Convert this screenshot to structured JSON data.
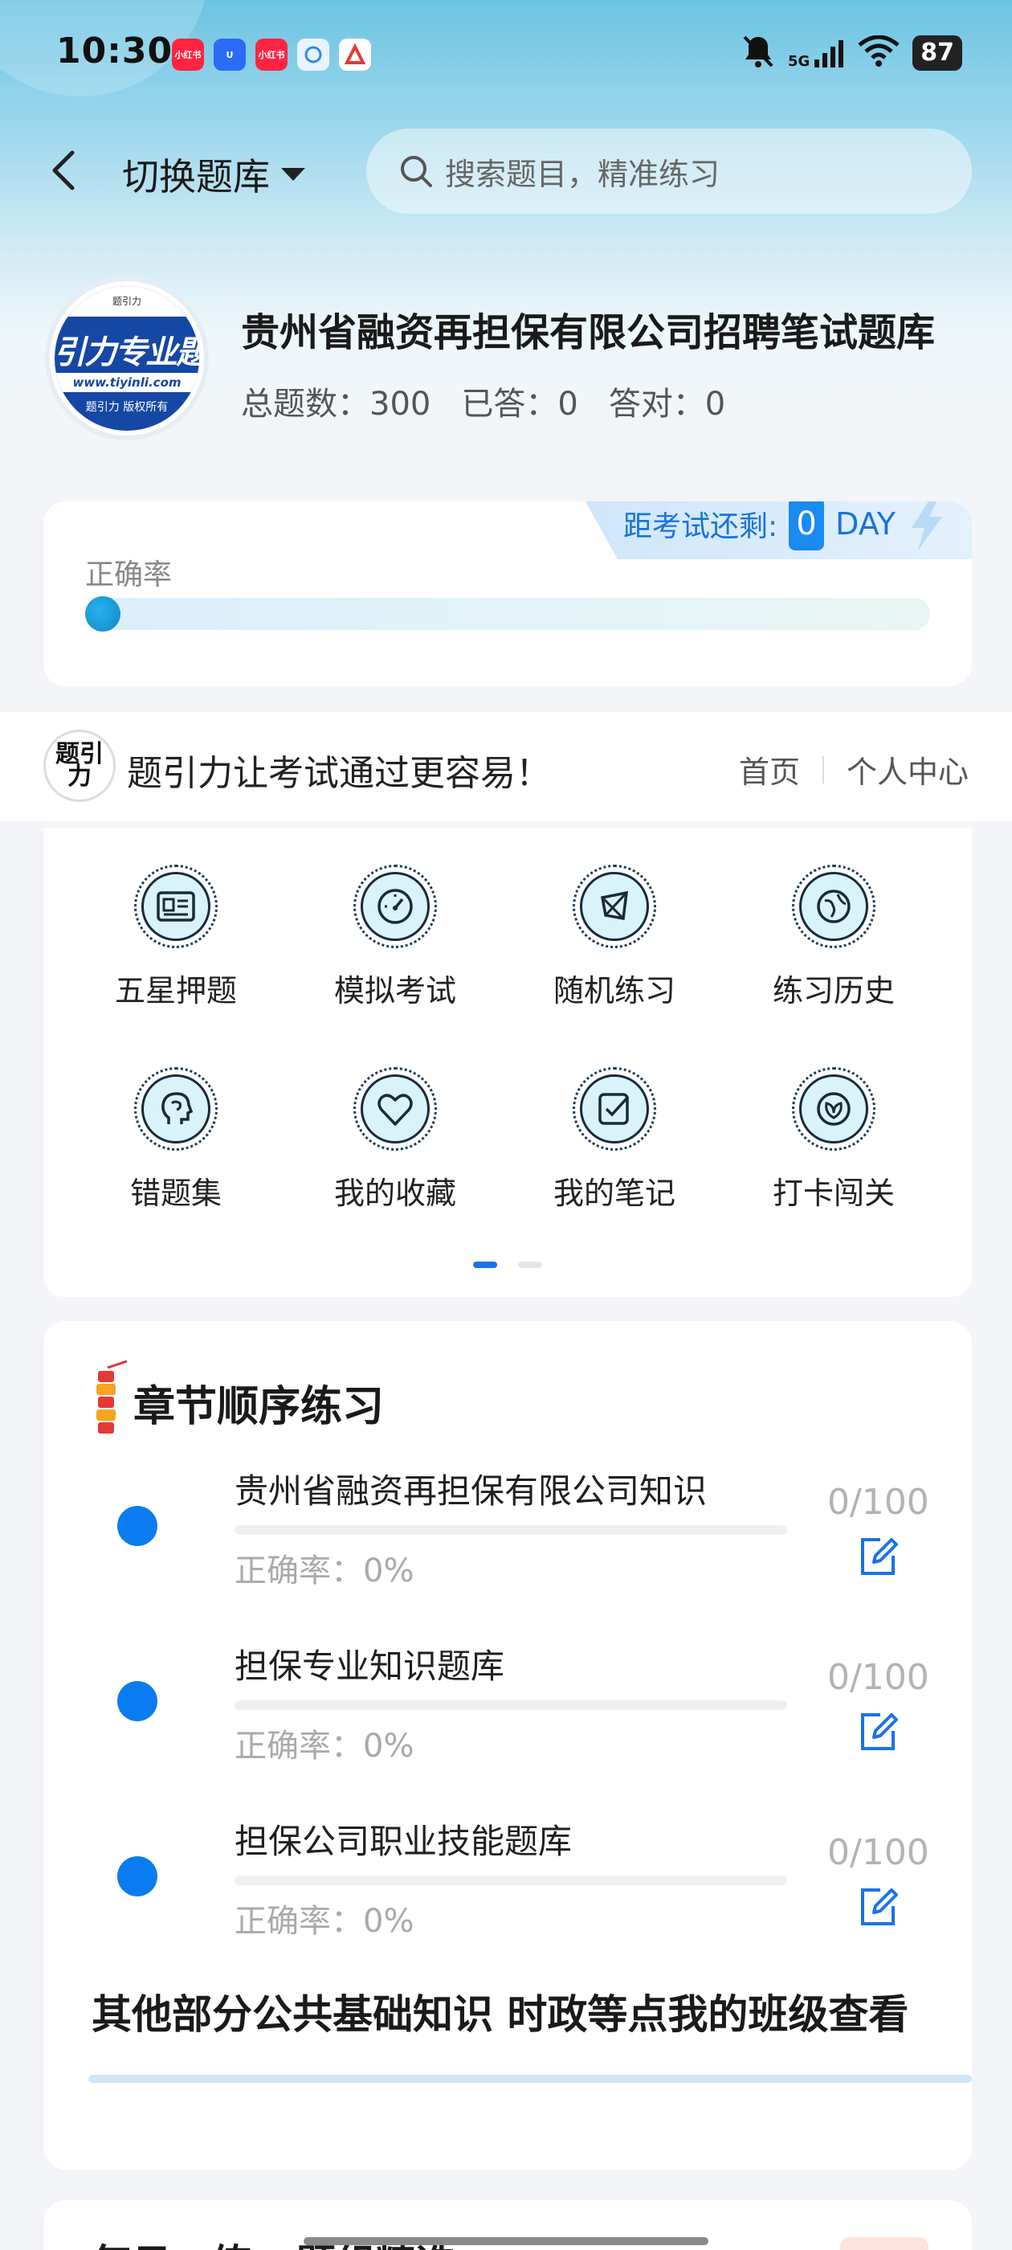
{
  "status_bar": {
    "time": "10:30",
    "network": "5G",
    "battery": "87",
    "apps": [
      {
        "name": "xiaohongshu-icon",
        "label": "小红书",
        "color": "#ff2442"
      },
      {
        "name": "app-blue-icon",
        "label": "U",
        "color": "#2a6df4"
      },
      {
        "name": "xiaohongshu-icon-2",
        "label": "小红书",
        "color": "#ff2442"
      },
      {
        "name": "chat-icon",
        "label": "",
        "color": "#e9f3ff"
      },
      {
        "name": "app-red-a-icon",
        "label": "A",
        "color": "#ffffff"
      }
    ]
  },
  "header": {
    "switch_label": "切换题库",
    "search_placeholder": "搜索题目，精准练习"
  },
  "bank": {
    "logo": {
      "top": "题引力",
      "main": "引力专业题",
      "url": "www.tiyinli.com",
      "foot": "题引力 版权所有"
    },
    "title": "贵州省融资再担保有限公司招聘笔试题库",
    "stats": {
      "total": "总题数：300",
      "answered": "已答：0",
      "correct": "答对：0"
    }
  },
  "accuracy_card": {
    "countdown_label": "距考试还剩:",
    "countdown_value": "0",
    "countdown_unit": "DAY",
    "label": "正确率",
    "accuracy": 0
  },
  "slogan": {
    "logo_text": "题引力",
    "text": "题引力让考试通过更容易！",
    "links": [
      "首页",
      "个人中心"
    ]
  },
  "features": [
    {
      "label": "五星押题",
      "icon": "id-card-icon"
    },
    {
      "label": "模拟考试",
      "icon": "speedometer-icon"
    },
    {
      "label": "随机练习",
      "icon": "random-network-icon"
    },
    {
      "label": "练习历史",
      "icon": "history-globe-icon"
    },
    {
      "label": "错题集",
      "icon": "brain-head-icon"
    },
    {
      "label": "我的收藏",
      "icon": "heart-icon"
    },
    {
      "label": "我的笔记",
      "icon": "checked-note-icon"
    },
    {
      "label": "打卡闯关",
      "icon": "leaf-badge-icon"
    }
  ],
  "chapter_practice": {
    "title": "章节顺序练习",
    "items": [
      {
        "name": "贵州省融资再担保有限公司知识",
        "accuracy": "正确率：0%",
        "progress": "0/100"
      },
      {
        "name": "担保专业知识题库",
        "accuracy": "正确率：0%",
        "progress": "0/100"
      },
      {
        "name": "担保公司职业技能题库",
        "accuracy": "正确率：0%",
        "progress": "0/100"
      }
    ],
    "other_link": "其他部分公共基础知识 时政等点我的班级查看"
  },
  "next_section_peek": "每日一练 · 题组精选"
}
